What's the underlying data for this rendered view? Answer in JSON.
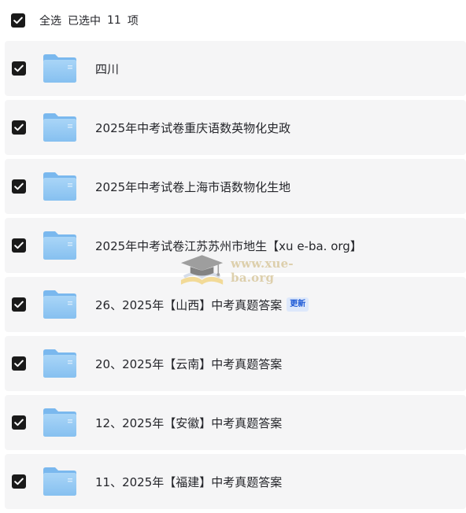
{
  "header": {
    "select_all_label": "全选",
    "selected_prefix": "已选中",
    "selected_count": "11",
    "selected_suffix": "项"
  },
  "items": [
    {
      "name": "四川",
      "badge": ""
    },
    {
      "name": "2025年中考试卷重庆语数英物化史政",
      "badge": ""
    },
    {
      "name": "2025年中考试卷上海市语数物化生地",
      "badge": ""
    },
    {
      "name": "2025年中考试卷江苏苏州市地生【xu e-ba. org】",
      "badge": ""
    },
    {
      "name": "26、2025年【山西】中考真题答案",
      "badge": "更新"
    },
    {
      "name": "20、2025年【云南】中考真题答案",
      "badge": ""
    },
    {
      "name": "12、2025年【安徽】中考真题答案",
      "badge": ""
    },
    {
      "name": "11、2025年【福建】中考真题答案",
      "badge": ""
    }
  ],
  "icons": {
    "checkbox": "checkbox-checked-icon",
    "folder": "folder-icon",
    "watermark": "graduation-cap-logo"
  },
  "watermark": {
    "text": "www.xue-ba.org"
  },
  "colors": {
    "checkbox_fill": "#1a1a1a",
    "row_background": "#f5f5f6",
    "folder_blue": "#8cc4f2",
    "badge_text": "#1e5ad6",
    "badge_background": "#dde8fb"
  }
}
